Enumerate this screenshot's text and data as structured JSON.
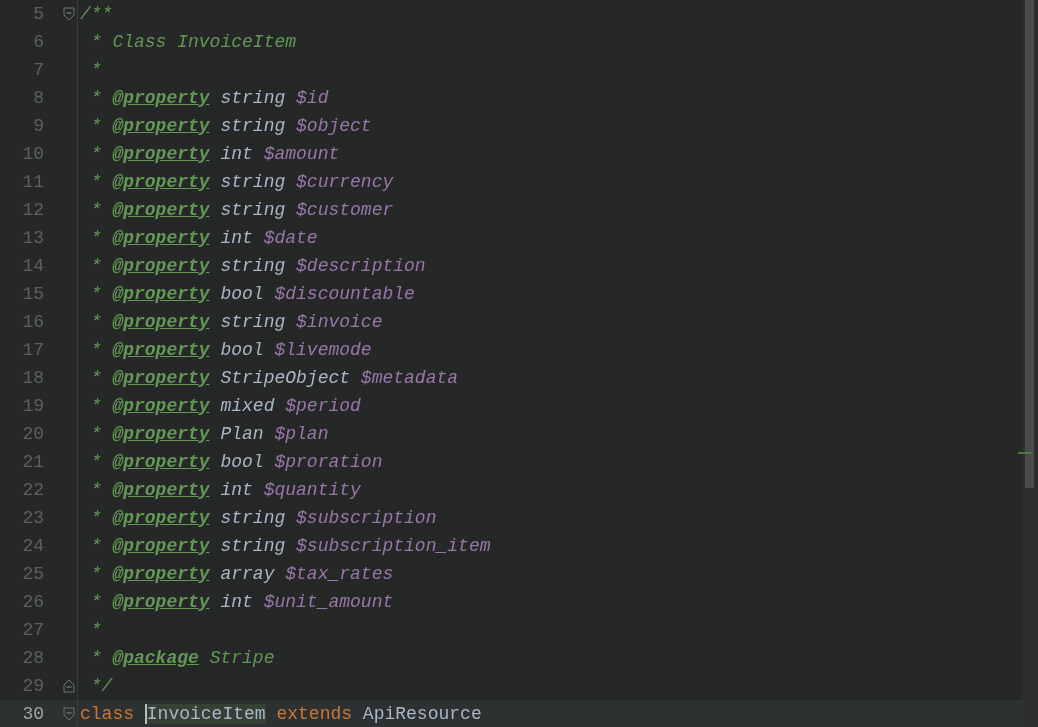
{
  "editor": {
    "lines": [
      {
        "number": "5",
        "kind": "fold-start",
        "current": false,
        "tokens": [
          {
            "kind": "comment",
            "text": "/**"
          }
        ]
      },
      {
        "number": "6",
        "kind": "plain",
        "current": false,
        "tokens": [
          {
            "kind": "comment",
            "text": " * Class InvoiceItem"
          }
        ]
      },
      {
        "number": "7",
        "kind": "plain",
        "current": false,
        "tokens": [
          {
            "kind": "comment",
            "text": " *"
          }
        ]
      },
      {
        "number": "8",
        "kind": "plain",
        "current": false,
        "tokens": [
          {
            "kind": "comment",
            "text": " * "
          },
          {
            "kind": "doc-tag",
            "text": "@property"
          },
          {
            "kind": "doc-type",
            "text": " string "
          },
          {
            "kind": "doc-var",
            "text": "$id"
          }
        ]
      },
      {
        "number": "9",
        "kind": "plain",
        "current": false,
        "tokens": [
          {
            "kind": "comment",
            "text": " * "
          },
          {
            "kind": "doc-tag",
            "text": "@property"
          },
          {
            "kind": "doc-type",
            "text": " string "
          },
          {
            "kind": "doc-var",
            "text": "$object"
          }
        ]
      },
      {
        "number": "10",
        "kind": "plain",
        "current": false,
        "tokens": [
          {
            "kind": "comment",
            "text": " * "
          },
          {
            "kind": "doc-tag",
            "text": "@property"
          },
          {
            "kind": "doc-type",
            "text": " int "
          },
          {
            "kind": "doc-var",
            "text": "$amount"
          }
        ]
      },
      {
        "number": "11",
        "kind": "plain",
        "current": false,
        "tokens": [
          {
            "kind": "comment",
            "text": " * "
          },
          {
            "kind": "doc-tag",
            "text": "@property"
          },
          {
            "kind": "doc-type",
            "text": " string "
          },
          {
            "kind": "doc-var",
            "text": "$currency"
          }
        ]
      },
      {
        "number": "12",
        "kind": "plain",
        "current": false,
        "tokens": [
          {
            "kind": "comment",
            "text": " * "
          },
          {
            "kind": "doc-tag",
            "text": "@property"
          },
          {
            "kind": "doc-type",
            "text": " string "
          },
          {
            "kind": "doc-var",
            "text": "$customer"
          }
        ]
      },
      {
        "number": "13",
        "kind": "plain",
        "current": false,
        "tokens": [
          {
            "kind": "comment",
            "text": " * "
          },
          {
            "kind": "doc-tag",
            "text": "@property"
          },
          {
            "kind": "doc-type",
            "text": " int "
          },
          {
            "kind": "doc-var",
            "text": "$date"
          }
        ]
      },
      {
        "number": "14",
        "kind": "plain",
        "current": false,
        "tokens": [
          {
            "kind": "comment",
            "text": " * "
          },
          {
            "kind": "doc-tag",
            "text": "@property"
          },
          {
            "kind": "doc-type",
            "text": " string "
          },
          {
            "kind": "doc-var",
            "text": "$description"
          }
        ]
      },
      {
        "number": "15",
        "kind": "plain",
        "current": false,
        "tokens": [
          {
            "kind": "comment",
            "text": " * "
          },
          {
            "kind": "doc-tag",
            "text": "@property"
          },
          {
            "kind": "doc-type",
            "text": " bool "
          },
          {
            "kind": "doc-var",
            "text": "$discountable"
          }
        ]
      },
      {
        "number": "16",
        "kind": "plain",
        "current": false,
        "tokens": [
          {
            "kind": "comment",
            "text": " * "
          },
          {
            "kind": "doc-tag",
            "text": "@property"
          },
          {
            "kind": "doc-type",
            "text": " string "
          },
          {
            "kind": "doc-var",
            "text": "$invoice"
          }
        ]
      },
      {
        "number": "17",
        "kind": "plain",
        "current": false,
        "tokens": [
          {
            "kind": "comment",
            "text": " * "
          },
          {
            "kind": "doc-tag",
            "text": "@property"
          },
          {
            "kind": "doc-type",
            "text": " bool "
          },
          {
            "kind": "doc-var",
            "text": "$livemode"
          }
        ]
      },
      {
        "number": "18",
        "kind": "plain",
        "current": false,
        "tokens": [
          {
            "kind": "comment",
            "text": " * "
          },
          {
            "kind": "doc-tag",
            "text": "@property"
          },
          {
            "kind": "doc-type",
            "text": " StripeObject "
          },
          {
            "kind": "doc-var",
            "text": "$metadata"
          }
        ]
      },
      {
        "number": "19",
        "kind": "plain",
        "current": false,
        "tokens": [
          {
            "kind": "comment",
            "text": " * "
          },
          {
            "kind": "doc-tag",
            "text": "@property"
          },
          {
            "kind": "doc-type",
            "text": " mixed "
          },
          {
            "kind": "doc-var",
            "text": "$period"
          }
        ]
      },
      {
        "number": "20",
        "kind": "plain",
        "current": false,
        "tokens": [
          {
            "kind": "comment",
            "text": " * "
          },
          {
            "kind": "doc-tag",
            "text": "@property"
          },
          {
            "kind": "doc-type",
            "text": " Plan "
          },
          {
            "kind": "doc-var",
            "text": "$plan"
          }
        ]
      },
      {
        "number": "21",
        "kind": "plain",
        "current": false,
        "tokens": [
          {
            "kind": "comment",
            "text": " * "
          },
          {
            "kind": "doc-tag",
            "text": "@property"
          },
          {
            "kind": "doc-type",
            "text": " bool "
          },
          {
            "kind": "doc-var",
            "text": "$proration"
          }
        ]
      },
      {
        "number": "22",
        "kind": "plain",
        "current": false,
        "tokens": [
          {
            "kind": "comment",
            "text": " * "
          },
          {
            "kind": "doc-tag",
            "text": "@property"
          },
          {
            "kind": "doc-type",
            "text": " int "
          },
          {
            "kind": "doc-var",
            "text": "$quantity"
          }
        ]
      },
      {
        "number": "23",
        "kind": "plain",
        "current": false,
        "tokens": [
          {
            "kind": "comment",
            "text": " * "
          },
          {
            "kind": "doc-tag",
            "text": "@property"
          },
          {
            "kind": "doc-type",
            "text": " string "
          },
          {
            "kind": "doc-var",
            "text": "$subscription"
          }
        ]
      },
      {
        "number": "24",
        "kind": "plain",
        "current": false,
        "tokens": [
          {
            "kind": "comment",
            "text": " * "
          },
          {
            "kind": "doc-tag",
            "text": "@property"
          },
          {
            "kind": "doc-type",
            "text": " string "
          },
          {
            "kind": "doc-var",
            "text": "$subscription_item"
          }
        ]
      },
      {
        "number": "25",
        "kind": "plain",
        "current": false,
        "tokens": [
          {
            "kind": "comment",
            "text": " * "
          },
          {
            "kind": "doc-tag",
            "text": "@property"
          },
          {
            "kind": "doc-type",
            "text": " array "
          },
          {
            "kind": "doc-var",
            "text": "$tax_rates"
          }
        ]
      },
      {
        "number": "26",
        "kind": "plain",
        "current": false,
        "tokens": [
          {
            "kind": "comment",
            "text": " * "
          },
          {
            "kind": "doc-tag",
            "text": "@property"
          },
          {
            "kind": "doc-type",
            "text": " int "
          },
          {
            "kind": "doc-var",
            "text": "$unit_amount"
          }
        ]
      },
      {
        "number": "27",
        "kind": "plain",
        "current": false,
        "tokens": [
          {
            "kind": "comment",
            "text": " *"
          }
        ]
      },
      {
        "number": "28",
        "kind": "plain",
        "current": false,
        "tokens": [
          {
            "kind": "comment",
            "text": " * "
          },
          {
            "kind": "doc-tag",
            "text": "@package"
          },
          {
            "kind": "comment",
            "text": " Stripe"
          }
        ]
      },
      {
        "number": "29",
        "kind": "fold-end",
        "current": false,
        "tokens": [
          {
            "kind": "comment",
            "text": " */"
          }
        ]
      },
      {
        "number": "30",
        "kind": "fold-start",
        "current": true,
        "tokens": [
          {
            "kind": "keyword",
            "text": "class "
          },
          {
            "kind": "class-name",
            "text": "InvoiceItem",
            "highlighted": true,
            "caret": true
          },
          {
            "kind": "keyword",
            "text": " extends "
          },
          {
            "kind": "class-name",
            "text": "ApiResource",
            "highlighted": false,
            "caret": false
          }
        ]
      }
    ]
  }
}
